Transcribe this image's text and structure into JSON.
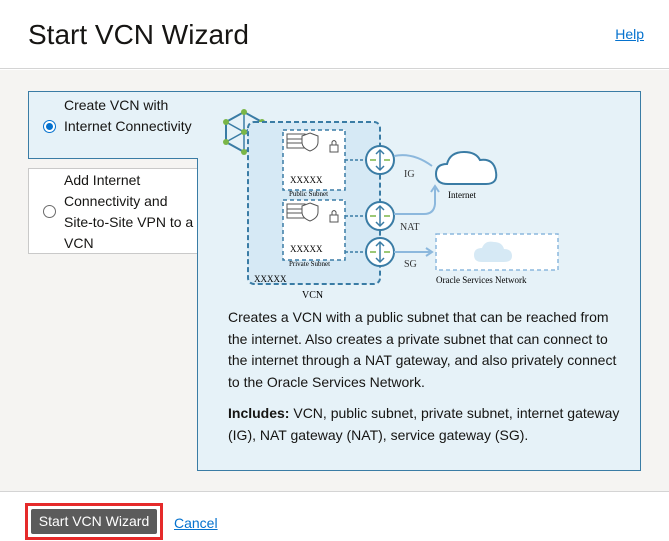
{
  "header": {
    "title": "Start VCN Wizard",
    "help_label": "Help"
  },
  "options": [
    {
      "label": "Create VCN with Internet Connectivity",
      "selected": true
    },
    {
      "label": "Add Internet Connectivity and Site-to-Site VPN to a VCN",
      "selected": false
    }
  ],
  "diagram": {
    "public_subnet": "Public Subnet",
    "private_subnet": "Private Subnet",
    "placeholder": "XXXXX",
    "vcn": "VCN",
    "ig": "IG",
    "nat": "NAT",
    "sg": "SG",
    "internet": "Internet",
    "oracle_services": "Oracle Services Network"
  },
  "panel": {
    "description": "Creates a VCN with a public subnet that can be reached from the internet. Also creates a private subnet that can connect to the internet through a NAT gateway, and also privately connect to the Oracle Services Network.",
    "includes_label": "Includes:",
    "includes_text": " VCN, public subnet, private subnet, internet gateway (IG), NAT gateway (NAT), service gateway (SG)."
  },
  "footer": {
    "start_button": "Start VCN Wizard",
    "cancel_label": "Cancel"
  },
  "colors": {
    "accent": "#0572ce",
    "selection_border": "#3a7ca5",
    "panel_bg": "#e6f2f8",
    "highlight": "#e52a2a"
  }
}
